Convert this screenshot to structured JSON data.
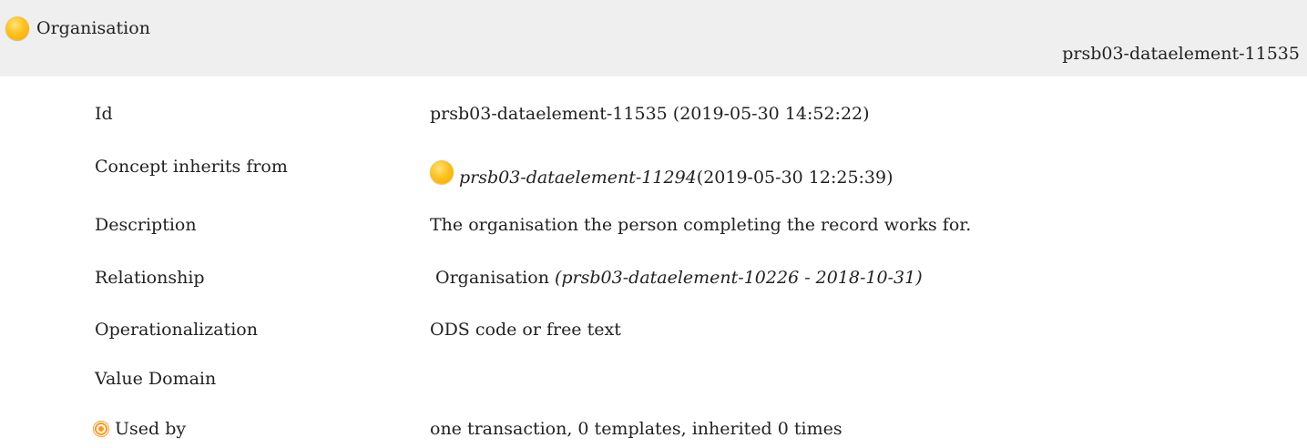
{
  "header": {
    "title": "Organisation",
    "id": "prsb03-dataelement-11535",
    "icon": "concept-orb-icon"
  },
  "rows": [
    {
      "label": "Id",
      "value": "prsb03-dataelement-11535 (2019-05-30 14:52:22)"
    },
    {
      "label": "Concept inherits from",
      "value_link": "prsb03-dataelement-11294",
      "value_suffix": " (2019-05-30 12:25:39)"
    },
    {
      "label": "Description",
      "value": "The organisation the person completing the record works for."
    },
    {
      "label": "Relationship",
      "value_main": "Organisation",
      "value_note": "(prsb03-dataelement-10226 - 2018-10-31)"
    },
    {
      "label": "Operationalization",
      "value": "ODS code or free text"
    },
    {
      "label": "Value Domain",
      "value": ""
    },
    {
      "label": "Used by",
      "value": "one transaction, 0 templates, inherited 0 times",
      "icon": "target-icon"
    }
  ],
  "colors": {
    "header_bg": "#efefef",
    "orb_yellow": "#ffc21a",
    "target_orange": "#ff9a1f"
  }
}
